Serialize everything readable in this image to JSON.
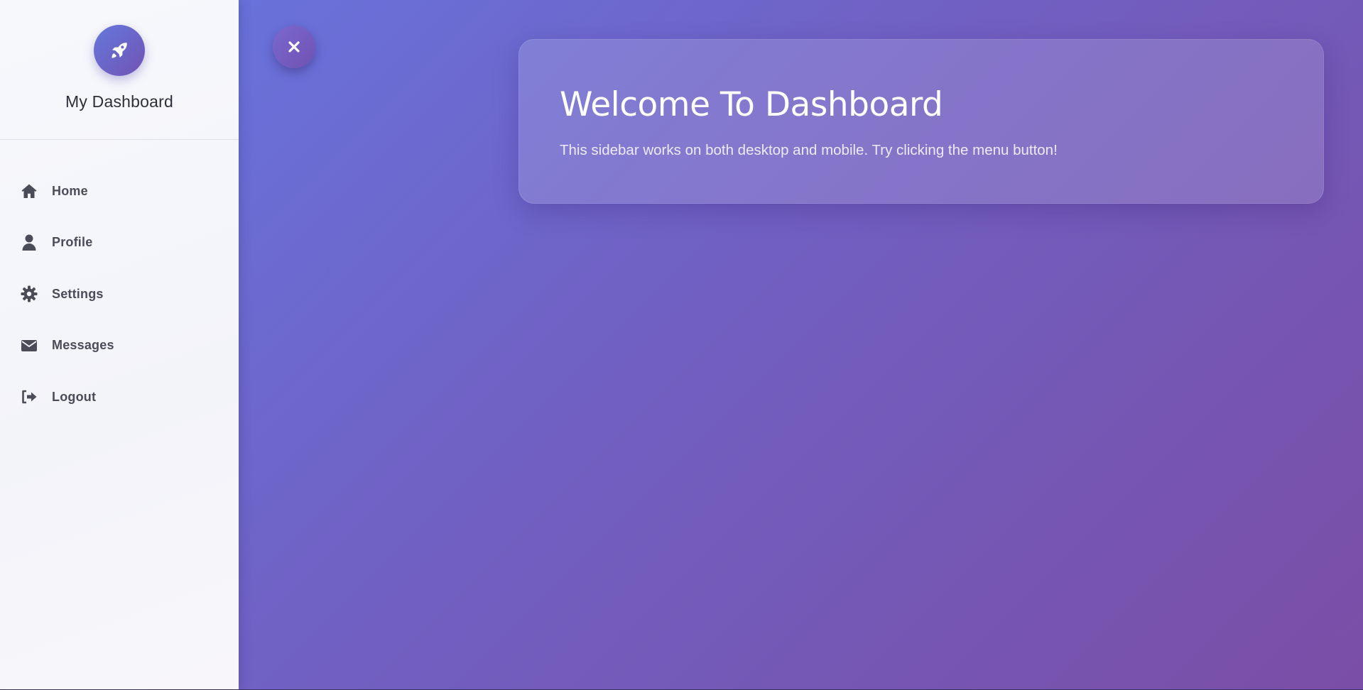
{
  "sidebar": {
    "brand": {
      "icon": "rocket-icon",
      "title": "My Dashboard"
    },
    "items": [
      {
        "label": "Home",
        "icon": "home-icon"
      },
      {
        "label": "Profile",
        "icon": "user-icon"
      },
      {
        "label": "Settings",
        "icon": "gear-icon"
      },
      {
        "label": "Messages",
        "icon": "envelope-icon"
      },
      {
        "label": "Logout",
        "icon": "logout-icon"
      }
    ]
  },
  "toggle": {
    "icon": "close-icon"
  },
  "welcome": {
    "title": "Welcome To Dashboard",
    "text": "This sidebar works on both desktop and mobile. Try clicking the menu button!"
  },
  "colors": {
    "gradient_start": "#6678e2",
    "gradient_end": "#7a4ea6",
    "sidebar_bg": "#f5f6fb",
    "nav_text": "#4a4c58"
  }
}
